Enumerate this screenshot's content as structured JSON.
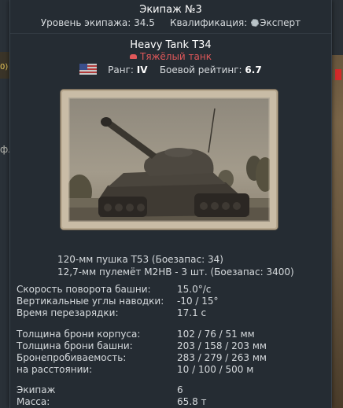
{
  "crew_card": {
    "title": "Экипаж №3",
    "level_label": "Уровень экипажа:",
    "level_value": "34.5",
    "qualification_label": "Квалификация:",
    "qualification_value": "Эксперт"
  },
  "vehicle": {
    "name": "Heavy Tank T34",
    "class": "Тяжёлый танк",
    "nation_flag": "usa-flag-icon",
    "rank_label": "Ранг:",
    "rank_value": "IV",
    "br_label": "Боевой рейтинг:",
    "br_value": "6.7"
  },
  "weapons": [
    "120-мм пушка T53 (Боезапас: 34)",
    "12,7-мм пулемёт M2HB - 3 шт. (Боезапас: 3400)"
  ],
  "stats_groups": [
    [
      {
        "label": "Скорость поворота башни:",
        "value": "15.0°/с"
      },
      {
        "label": "Вертикальные углы наводки:",
        "value": "-10 / 15°"
      },
      {
        "label": "Время перезарядки:",
        "value": "17.1 с"
      }
    ],
    [
      {
        "label": "Толщина брони корпуса:",
        "value": "102 / 76 / 51 мм"
      },
      {
        "label": "Толщина брони башни:",
        "value": "203 / 158 / 203 мм"
      },
      {
        "label": "Бронепробиваемость:",
        "value": "283 / 279 / 263 мм"
      },
      {
        "label": "на расстоянии:",
        "value": "10 / 100 / 500 м"
      }
    ],
    [
      {
        "label": "Экипаж",
        "value": "6"
      },
      {
        "label": "Масса:",
        "value": "65.8 т"
      }
    ]
  ],
  "background": {
    "left_fragment_1": "0)",
    "left_fragment_2": "фл"
  },
  "colors": {
    "panel_bg": "#252c33",
    "class_red": "#e0585a",
    "text_white": "#ffffff",
    "text_main": "#d6dadd"
  }
}
